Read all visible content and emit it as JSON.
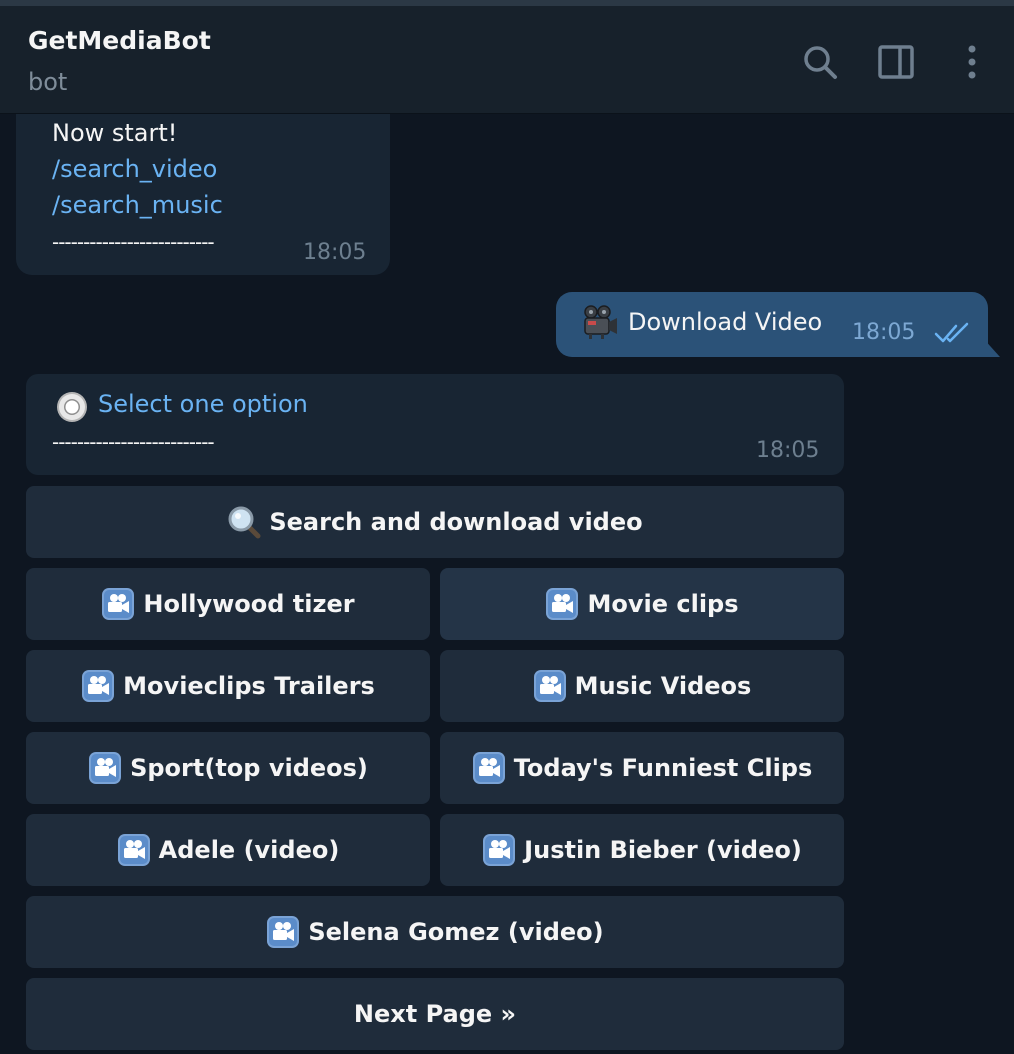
{
  "header": {
    "title": "GetMediaBot",
    "subtitle": "bot"
  },
  "messages": {
    "intro": {
      "text": "Now start!",
      "link1": "/search_video",
      "link2": "/search_music",
      "divider": "--------------------------",
      "time": "18:05"
    },
    "outgoing": {
      "icon": "movie-camera-icon",
      "text": "Download Video",
      "time": "18:05",
      "status": "read"
    },
    "select": {
      "icon": "radio-button-icon",
      "text": "Select one option",
      "divider": "--------------------------",
      "time": "18:05"
    }
  },
  "keyboard": {
    "search": "Search and download video",
    "hollywood": "Hollywood tizer",
    "movie_clips": "Movie clips",
    "movieclips_trailers": "Movieclips Trailers",
    "music_videos": "Music Videos",
    "sport": "Sport(top videos)",
    "funniest": "Today's Funniest Clips",
    "adele": "Adele (video)",
    "bieber": "Justin Bieber (video)",
    "selena": "Selena Gomez (video)",
    "next": "Next Page »"
  },
  "colors": {
    "background": "#0e1621",
    "header": "#17212b",
    "incoming_bubble": "#182533",
    "outgoing_bubble": "#2b5278",
    "link": "#6ab3f3",
    "button": "#1f2c3b"
  }
}
